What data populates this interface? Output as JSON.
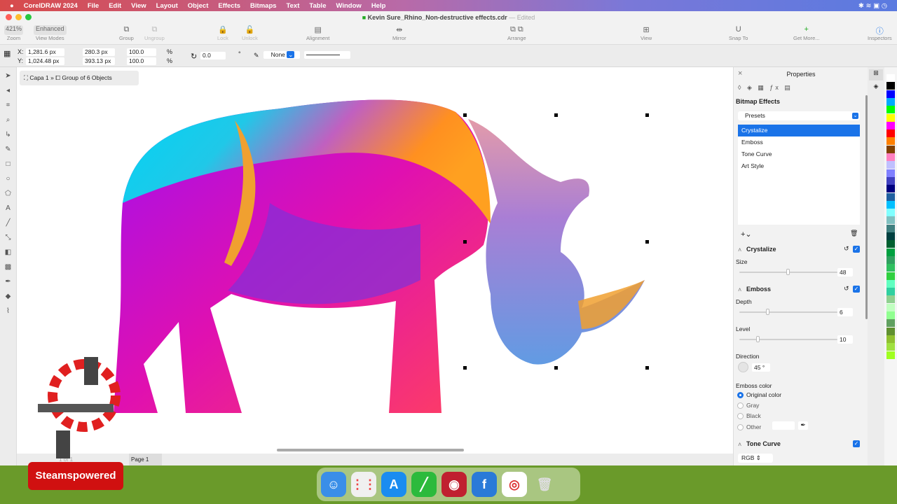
{
  "menubar": {
    "items": [
      "CorelDRAW 2024",
      "File",
      "Edit",
      "View",
      "Layout",
      "Object",
      "Effects",
      "Bitmaps",
      "Text",
      "Table",
      "Window",
      "Help"
    ]
  },
  "titlebar": {
    "title": "Kevin Sure_Rhino_Non-destructive effects.cdr",
    "status": "— Edited"
  },
  "toolbar": {
    "zoom": "421%",
    "view_mode": "Enhanced",
    "labels": [
      "Zoom",
      "View Modes",
      "Group",
      "Ungroup",
      "Lock",
      "Unlock",
      "Alignment",
      "Mirror",
      "Arrange",
      "View",
      "Snap To",
      "Get More...",
      "Inspectors"
    ]
  },
  "propbar": {
    "x": "1,281.6 px",
    "y": "1,024.48 px",
    "w": "280.3 px",
    "h": "393.13 px",
    "sx": "100.0",
    "sy": "100.0",
    "pct": "%",
    "rotation": "0.0",
    "deg": "°",
    "outline": "None"
  },
  "breadcrumb": {
    "layer": "Capa 1",
    "object": "Group of 6 Objects"
  },
  "pagebar": {
    "page": "Page 1",
    "count": "1 of 1"
  },
  "panel": {
    "title": "Properties",
    "section": "Bitmap Effects",
    "presets": "Presets",
    "effects": [
      "Crystalize",
      "Emboss",
      "Tone Curve",
      "Art Style"
    ],
    "selected": 0,
    "crystalize": {
      "title": "Crystalize",
      "size_label": "Size",
      "size": "48",
      "size_frac": 0.48
    },
    "emboss": {
      "title": "Emboss",
      "depth_label": "Depth",
      "depth": "6",
      "depth_frac": 0.27,
      "level_label": "Level",
      "level": "10",
      "level_frac": 0.17,
      "direction_label": "Direction",
      "direction": "45 °",
      "color_label": "Emboss color",
      "options": [
        "Original color",
        "Gray",
        "Black",
        "Other"
      ]
    },
    "tone": {
      "title": "Tone Curve",
      "channel": "RGB"
    }
  },
  "palette": [
    "#ffffff",
    "#000000",
    "#0000ff",
    "#00aaff",
    "#00ff00",
    "#ffff00",
    "#ff00ff",
    "#ff0000",
    "#ff8000",
    "#804000",
    "#ff80c0",
    "#c0c0ff",
    "#8080ff",
    "#4040c0",
    "#000080",
    "#2060a0",
    "#00c0ff",
    "#80ffff",
    "#80c0c0",
    "#408080",
    "#004040",
    "#006030",
    "#00a040",
    "#30a060",
    "#30c060",
    "#30d040",
    "#60ffc0",
    "#30d0a0",
    "#90d090",
    "#c0ffc0",
    "#90ff90",
    "#60a060",
    "#609030",
    "#90c030",
    "#a0e040",
    "#a0ff20"
  ],
  "watermark": "Steamspowered"
}
